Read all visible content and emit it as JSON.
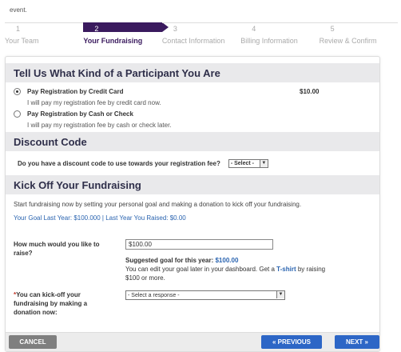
{
  "top_text": "event.",
  "steps": [
    {
      "num": "1",
      "label": "Your Team"
    },
    {
      "num": "2",
      "label": "Your Fundraising"
    },
    {
      "num": "3",
      "label": "Contact Information"
    },
    {
      "num": "4",
      "label": "Billing Information"
    },
    {
      "num": "5",
      "label": "Review & Confirm"
    }
  ],
  "participant": {
    "title": "Tell Us What Kind of a Participant You Are",
    "opt1_label": "Pay Registration by Credit Card",
    "opt1_sub": "I will pay my registration fee by credit card now.",
    "opt1_price": "$10.00",
    "opt2_label": "Pay Registration by Cash or Check",
    "opt2_sub": "I will pay my registration fee by cash or check later."
  },
  "discount": {
    "title": "Discount Code",
    "question": "Do you have a discount code to use towards your registration fee?",
    "select_value": "- Select -"
  },
  "kickoff": {
    "title": "Kick Off Your Fundraising",
    "intro": "Start fundraising now by setting your personal goal and making a donation to kick off your fundraising.",
    "goal_line": "Your Goal Last Year: $100.000 | Last Year You Raised: $0.00",
    "raise_label": "How much would you like to raise?",
    "raise_value": "$100.00",
    "suggested_prefix": "Suggested goal for this year:",
    "suggested_value": "$100.00",
    "edit_text_1": "You can edit your goal later in your dashboard. Get a",
    "tshirt": "T-shirt",
    "edit_text_2": "by raising",
    "edit_text_3": "$100 or more.",
    "kickoff_label_star": "*",
    "kickoff_label": "You can kick-off your fundraising by making a donation now:",
    "kickoff_select": "- Select a response -"
  },
  "buttons": {
    "cancel": "CANCEL",
    "previous": "« PREVIOUS",
    "next": "NEXT »"
  },
  "colors": {
    "accent": "#3a1a5e",
    "link": "#2a64b0",
    "button_blue": "#2d66c6"
  }
}
